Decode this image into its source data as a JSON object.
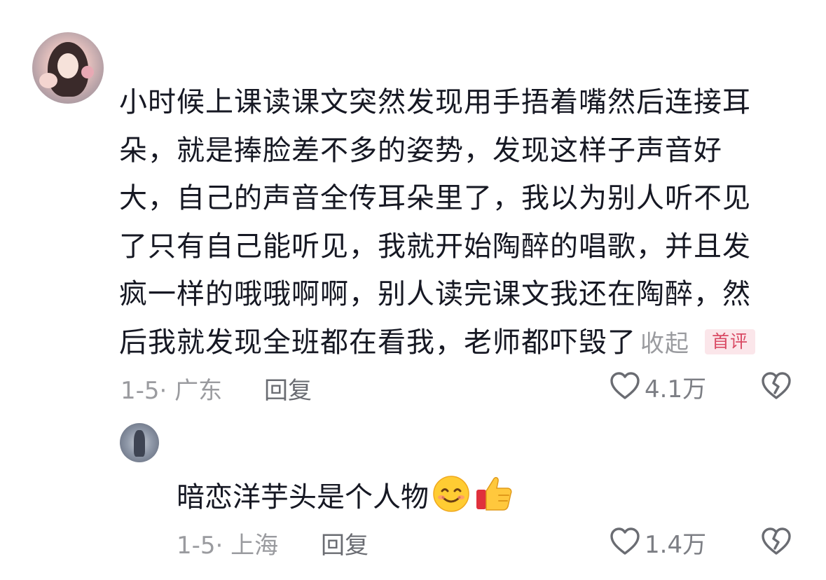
{
  "comment": {
    "lines": [
      "小时候上课读课文突然发现用手捂着嘴然后连接耳",
      "朵，就是捧脸差不多的姿势，发现这样子声音好",
      "大，自己的声音全传耳朵里了，我以为别人听不见",
      "了只有自己能听见，我就开始陶醉的唱歌，并且发",
      "疯一样的哦哦啊啊，别人读完课文我还在陶醉，然",
      "后我就发现全班都在看我，老师都吓毁了"
    ],
    "collapse_label": "收起",
    "badge_label": "首评",
    "date_location": "1-5· 广东",
    "reply_label": "回复",
    "like_count": "4.1万"
  },
  "reply": {
    "text": "暗恋洋芋头是个人物",
    "emojis": [
      "smile-emoji",
      "thumbs-up-emoji"
    ],
    "date_location": "1-5· 上海",
    "reply_label": "回复",
    "like_count": "1.4万"
  },
  "colors": {
    "text": "#161823",
    "meta": "#9a9b9f",
    "badge_text": "#d94a64",
    "badge_bg": "#fbe6ea"
  }
}
